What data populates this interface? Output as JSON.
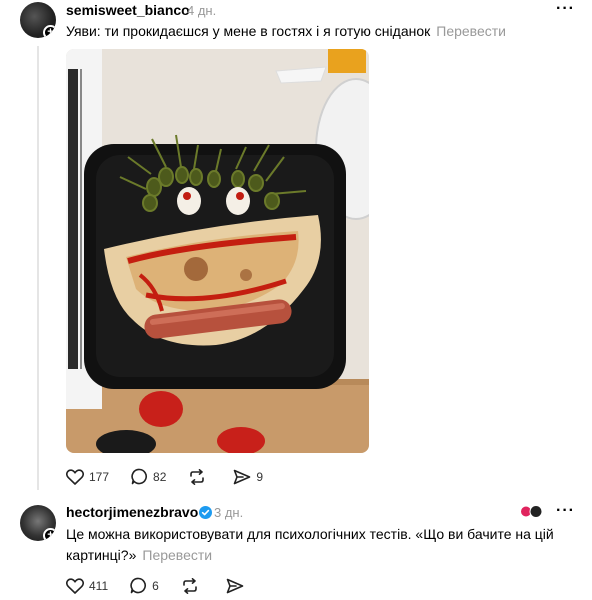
{
  "post1": {
    "username": "semisweet_bianco",
    "time": "4 дн.",
    "more": "···",
    "text": "Уяви: ти прокидаєшся у мене в гостях і я готую сніданок",
    "translate": "Перевести",
    "likes": "177",
    "comments": "82",
    "shares": "9"
  },
  "post2": {
    "username": "hectorjimenezbravo",
    "time": "3 дн.",
    "more": "···",
    "text": "Це можна використовувати для психологічних тестів. «Що ви бачите на цій картинці?»",
    "translate": "Перевести",
    "likes": "411",
    "comments": "6"
  },
  "colors": {
    "verified": "#1d9bf0",
    "muted": "#999999",
    "divider": "#e5e5e5"
  }
}
